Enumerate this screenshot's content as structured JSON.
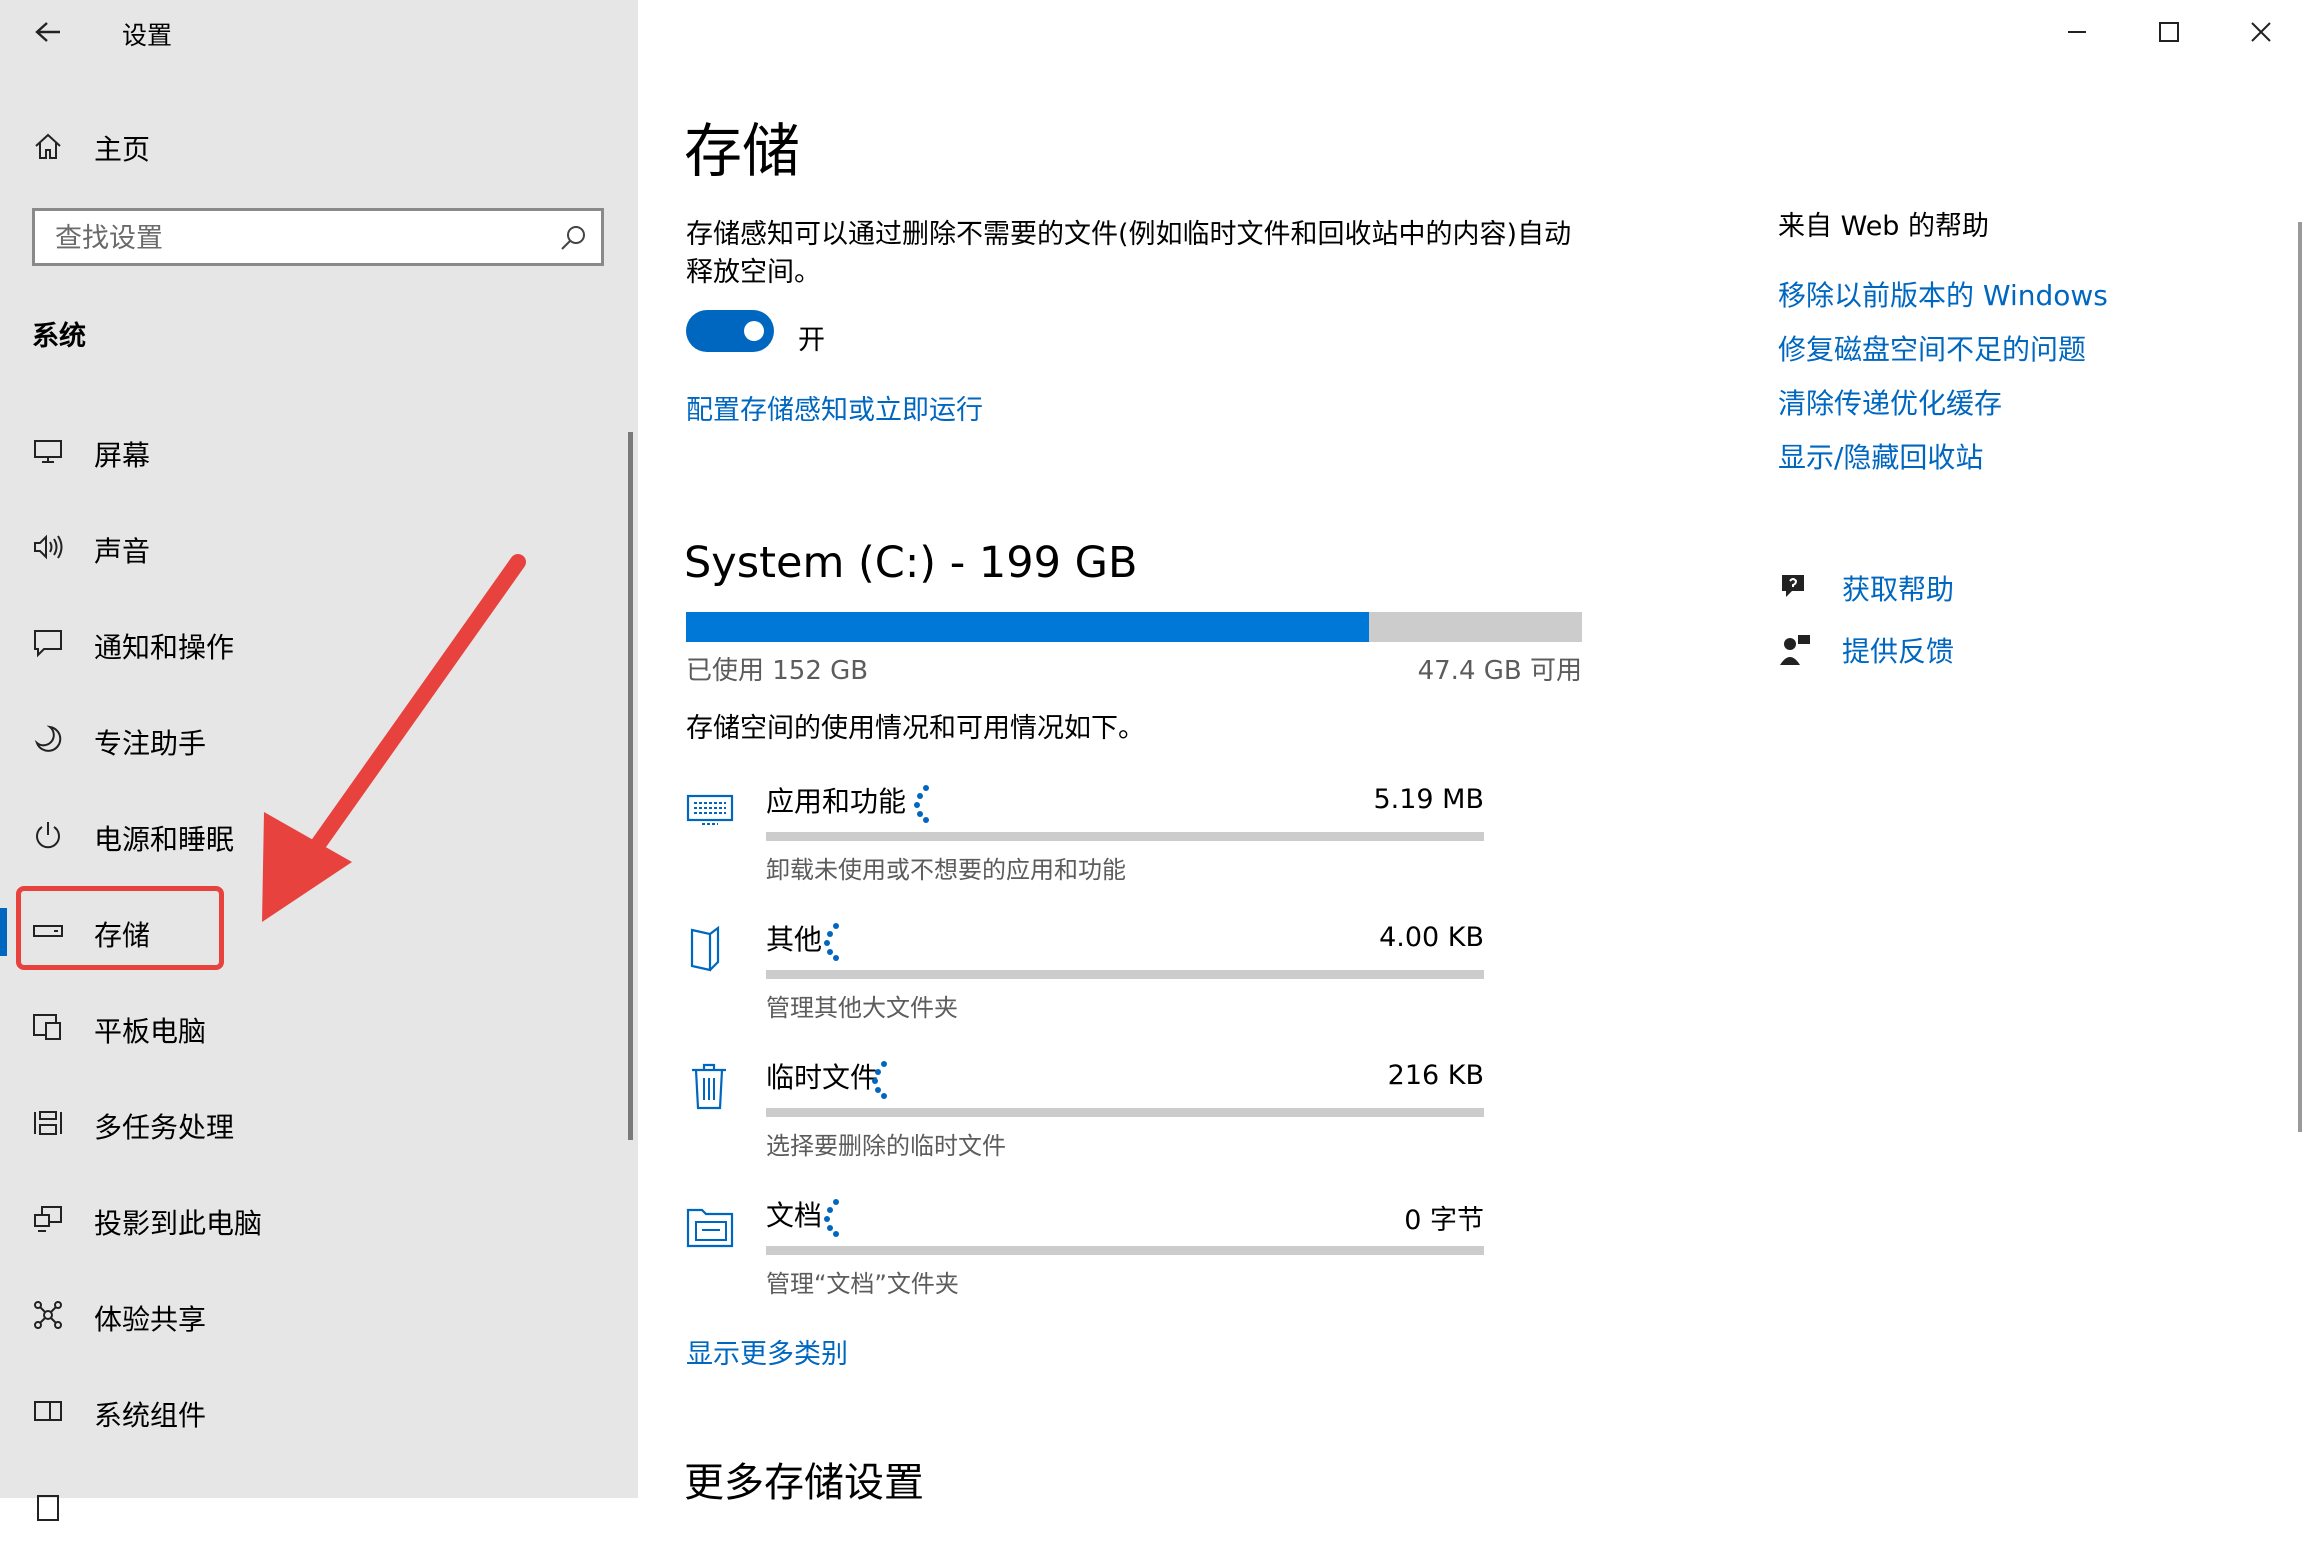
{
  "window": {
    "title": "设置",
    "controls": {
      "minimize": "minimize-icon",
      "maximize": "maximize-icon",
      "close": "close-icon"
    }
  },
  "sidebar": {
    "home_label": "主页",
    "search_placeholder": "查找设置",
    "section": "系统",
    "items": [
      {
        "label": "屏幕",
        "icon": "monitor-icon"
      },
      {
        "label": "声音",
        "icon": "speaker-icon"
      },
      {
        "label": "通知和操作",
        "icon": "notification-icon"
      },
      {
        "label": "专注助手",
        "icon": "moon-icon"
      },
      {
        "label": "电源和睡眠",
        "icon": "power-icon"
      },
      {
        "label": "存储",
        "icon": "storage-icon",
        "selected": true
      },
      {
        "label": "平板电脑",
        "icon": "tablet-icon"
      },
      {
        "label": "多任务处理",
        "icon": "multitask-icon"
      },
      {
        "label": "投影到此电脑",
        "icon": "projection-icon"
      },
      {
        "label": "体验共享",
        "icon": "share-icon"
      },
      {
        "label": "系统组件",
        "icon": "components-icon"
      }
    ],
    "accent_color": "#0067c0",
    "annotation_color": "#e8423f"
  },
  "main": {
    "title": "存储",
    "storage_sense_desc": "存储感知可以通过删除不需要的文件(例如临时文件和回收站中的内容)自动释放空间。",
    "toggle_state": "开",
    "toggle_on": true,
    "config_link": "配置存储感知或立即运行",
    "drive": {
      "title": "System (C:) - 199 GB",
      "used_label": "已使用 152 GB",
      "free_label": "47.4 GB 可用",
      "used_fraction": 0.762
    },
    "usage_desc": "存储空间的使用情况和可用情况如下。",
    "categories": [
      {
        "name": "应用和功能",
        "size": "5.19 MB",
        "sub": "卸载未使用或不想要的应用和功能",
        "icon": "keyboard-icon",
        "fill_fraction": 0
      },
      {
        "name": "其他",
        "size": "4.00 KB",
        "sub": "管理其他大文件夹",
        "icon": "other-files-icon",
        "fill_fraction": 0
      },
      {
        "name": "临时文件",
        "size": "216 KB",
        "sub": "选择要删除的临时文件",
        "icon": "trash-icon",
        "fill_fraction": 0
      },
      {
        "name": "文档",
        "size": "0 字节",
        "sub": "管理“文档”文件夹",
        "icon": "documents-folder-icon",
        "fill_fraction": 0
      }
    ],
    "more_categories": "显示更多类别",
    "more_settings": "更多存储设置"
  },
  "help": {
    "title": "来自 Web 的帮助",
    "links": [
      "移除以前版本的 Windows",
      "修复磁盘空间不足的问题",
      "清除传递优化缓存",
      "显示/隐藏回收站"
    ],
    "get_help": "获取帮助",
    "feedback": "提供反馈"
  }
}
